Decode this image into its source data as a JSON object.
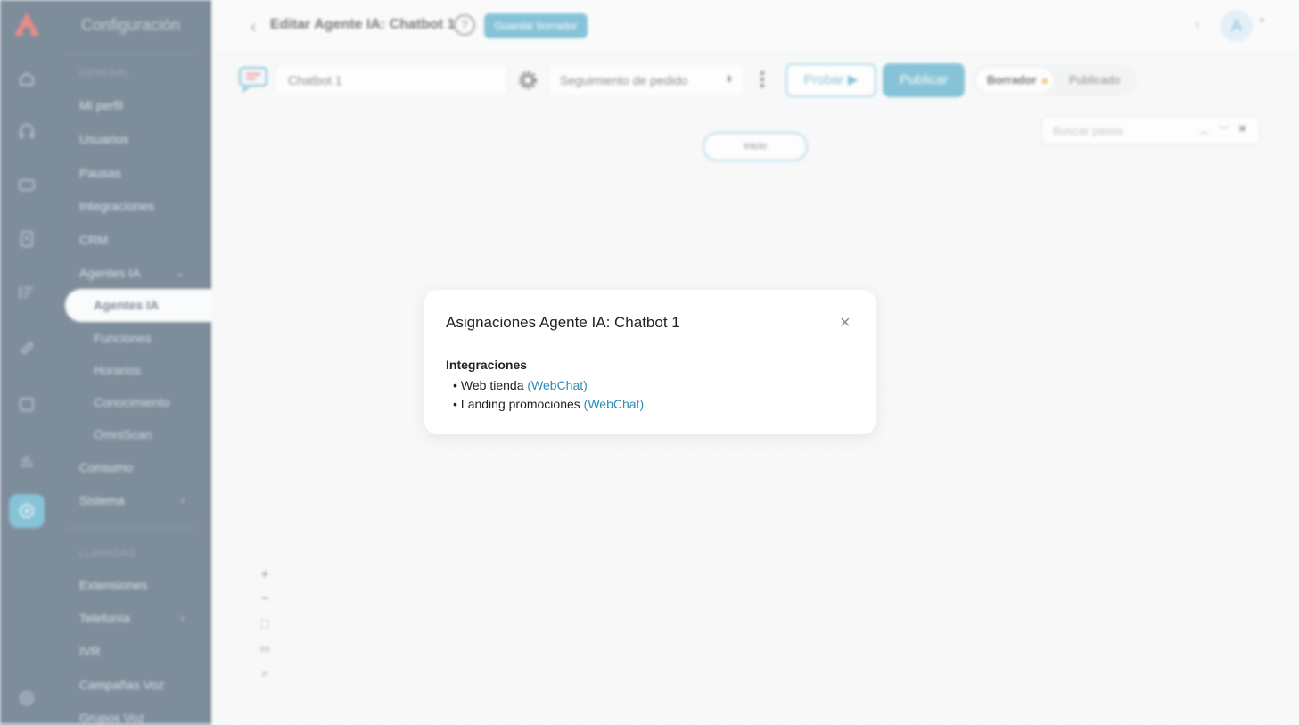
{
  "sidebar": {
    "title": "Configuración",
    "section_general": "GENERAL",
    "items_general": [
      "Mi perfil",
      "Usuarios",
      "Pausas",
      "Integraciones",
      "CRM"
    ],
    "agentes_group": "Agentes IA",
    "sub_items": [
      "Agentes IA",
      "Funciones",
      "Horarios",
      "Conocimiento",
      "OmniScan"
    ],
    "items_after": [
      "Consumo",
      "Sistema"
    ],
    "section_llamadas": "LLAMADAS",
    "items_llamadas": [
      "Extensiones",
      "Telefonía",
      "IVR",
      "Campañas Voz",
      "Grupos Voz"
    ]
  },
  "header": {
    "title": "Editar Agente IA: Chatbot 1",
    "help": "?",
    "save_draft": "Guardar borrador",
    "avatar": "A"
  },
  "toolbar": {
    "name_value": "Chatbot 1",
    "flow_select": "Seguimiento de pedido",
    "test_label": "Probar",
    "publish_label": "Publicar",
    "status_draft": "Borrador",
    "status_published": "Publicado"
  },
  "canvas": {
    "search_placeholder": "Buscar pasos",
    "start_node": "Inicio"
  },
  "modal": {
    "title": "Asignaciones Agente IA: Chatbot 1",
    "close": "×",
    "section": "Integraciones",
    "items": [
      {
        "name": "Web tienda",
        "channel": "(WebChat)"
      },
      {
        "name": "Landing promociones",
        "channel": "(WebChat)"
      }
    ]
  },
  "colors": {
    "accent": "#4aa7c6",
    "sidebar": "#3d5469",
    "link": "#2c8db6"
  }
}
